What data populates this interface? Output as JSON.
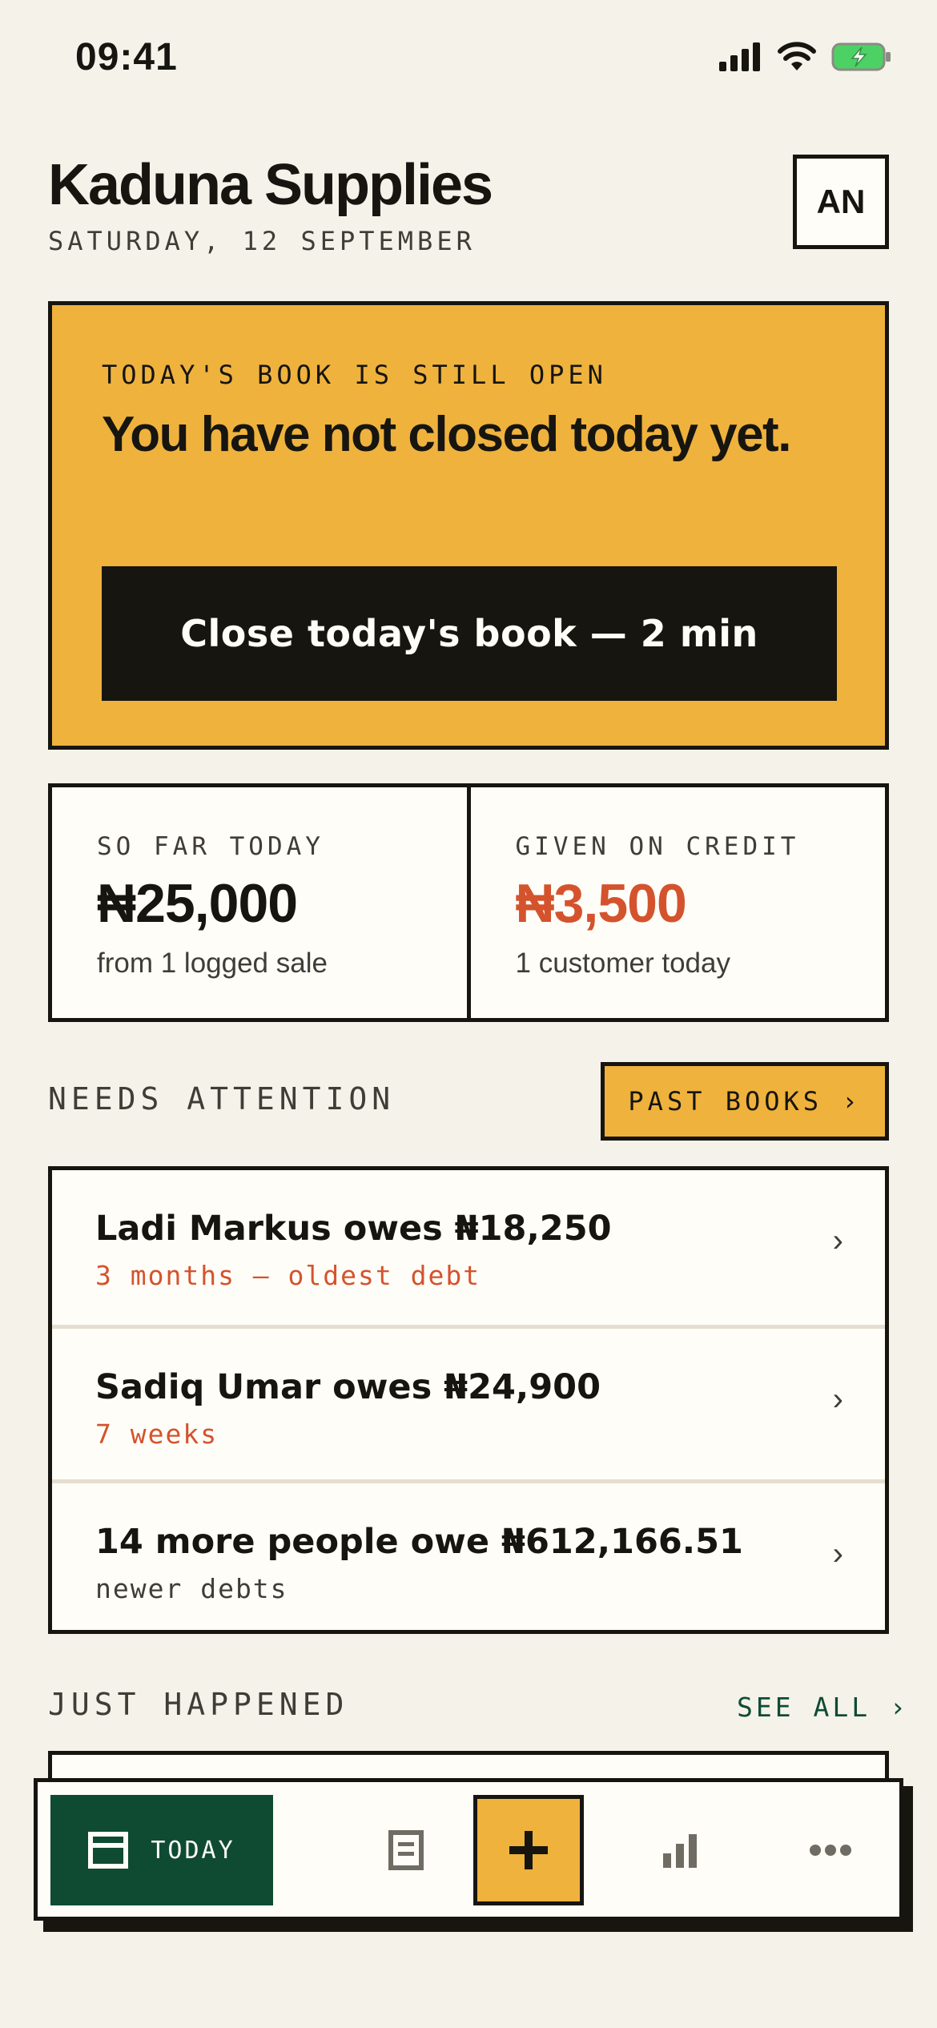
{
  "status_bar": {
    "time": "09:41"
  },
  "header": {
    "title": "Kaduna Supplies",
    "date": "SATURDAY, 12 SEPTEMBER",
    "avatar_initials": "AN"
  },
  "banner": {
    "eyebrow": "TODAY'S BOOK IS STILL OPEN",
    "heading": "You have not closed today yet.",
    "button_label": "Close today's book — 2 min"
  },
  "stats": {
    "so_far": {
      "label": "SO FAR TODAY",
      "value": "₦25,000",
      "note": "from 1 logged sale"
    },
    "credit": {
      "label": "GIVEN ON CREDIT",
      "value": "₦3,500",
      "note": "1 customer today"
    }
  },
  "attention": {
    "label": "NEEDS ATTENTION",
    "past_books_label": "PAST BOOKS ›",
    "items": [
      {
        "title": "Ladi Markus owes ₦18,250",
        "subtitle": "3 months — oldest debt"
      },
      {
        "title": "Sadiq Umar owes ₦24,900",
        "subtitle": "7 weeks"
      },
      {
        "title": "14 more people owe ₦612,166.51",
        "subtitle": "newer debts"
      }
    ],
    "chevron": "›"
  },
  "recent": {
    "label": "JUST HAPPENED",
    "see_all_label": "SEE ALL ›"
  },
  "tab_bar": {
    "today_label": "TODAY",
    "add_symbol": "+"
  },
  "colors": {
    "background": "#f5f2ea",
    "accent_yellow": "#efb23d",
    "ink": "#161510",
    "credit_red": "#d4532d",
    "brand_green": "#0f4b33"
  }
}
